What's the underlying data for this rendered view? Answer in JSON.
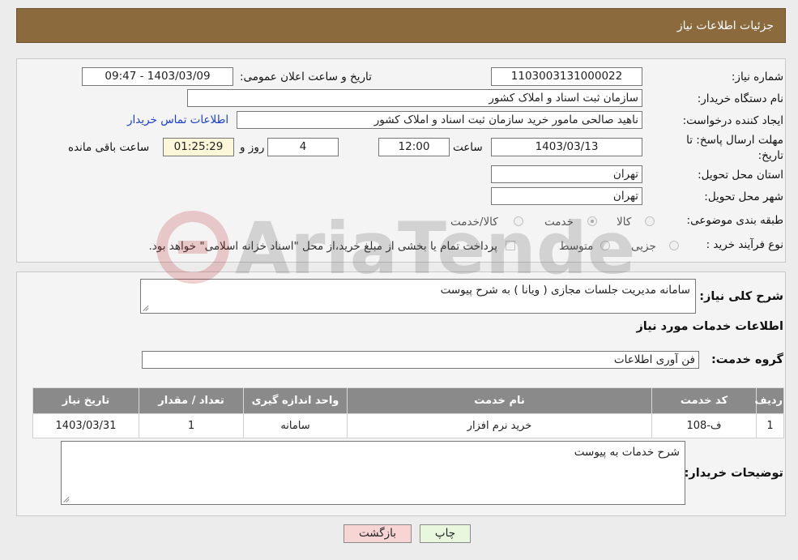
{
  "header": {
    "title": "جزئیات اطلاعات نیاز"
  },
  "info": {
    "need_number_label": "شماره نیاز:",
    "need_number": "1103003131000022",
    "announce_label": "تاریخ و ساعت اعلان عمومی:",
    "announce_value": "1403/03/09 - 09:47",
    "buyer_org_label": "نام دستگاه خریدار:",
    "buyer_org": "سازمان ثبت اسناد و املاک کشور",
    "creator_label": "ایجاد کننده درخواست:",
    "creator": "ناهید صالحی مامور خرید سازمان ثبت اسناد و املاک کشور",
    "contact_link": "اطلاعات تماس خریدار",
    "deadline_label_1": "مهلت ارسال پاسخ: تا",
    "deadline_label_2": "تاریخ:",
    "deadline_date": "1403/03/13",
    "time_label": "ساعت",
    "deadline_time": "12:00",
    "days_value": "4",
    "days_label": "روز و",
    "remaining_time": "01:25:29",
    "remaining_label": "ساعت باقی مانده",
    "province_label": "استان محل تحویل:",
    "province": "تهران",
    "city_label": "شهر محل تحویل:",
    "city": "تهران",
    "category_label": "طبقه بندی موضوعی:",
    "category_options": [
      "کالا",
      "خدمت",
      "کالا/خدمت"
    ],
    "category_selected": "خدمت",
    "process_label": "نوع فرآیند خرید :",
    "process_options": [
      "جزیی",
      "متوسط"
    ],
    "payment_note": "پرداخت تمام یا بخشی از مبلغ خرید،از محل \"اسناد خزانه اسلامی\" خواهد بود."
  },
  "details": {
    "summary_label": "شرح کلی نیاز:",
    "summary": "سامانه مدیریت جلسات مجازی ( ویانا ) به شرح پیوست",
    "services_heading": "اطلاعات خدمات مورد نیاز",
    "group_label": "گروه خدمت:",
    "group": "فن آوری اطلاعات",
    "table": {
      "headers": [
        "ردیف",
        "کد خدمت",
        "نام خدمت",
        "واحد اندازه گیری",
        "تعداد / مقدار",
        "تاریخ نیاز"
      ],
      "rows": [
        [
          "1",
          "ف-108",
          "خرید نرم افزار",
          "سامانه",
          "1",
          "1403/03/31"
        ]
      ]
    },
    "buyer_notes_label": "توضیحات خریدار:",
    "buyer_notes": "شرح خدمات به پیوست"
  },
  "buttons": {
    "print": "چاپ",
    "back": "بازگشت"
  },
  "watermark": "AriaTender.net",
  "colors": {
    "header_bg": "#8b6a3e",
    "table_header_bg": "#8a8a8a",
    "back_button_bg": "#f7d5d5",
    "print_button_bg": "#e9f7df",
    "link": "#1a3fd0"
  }
}
